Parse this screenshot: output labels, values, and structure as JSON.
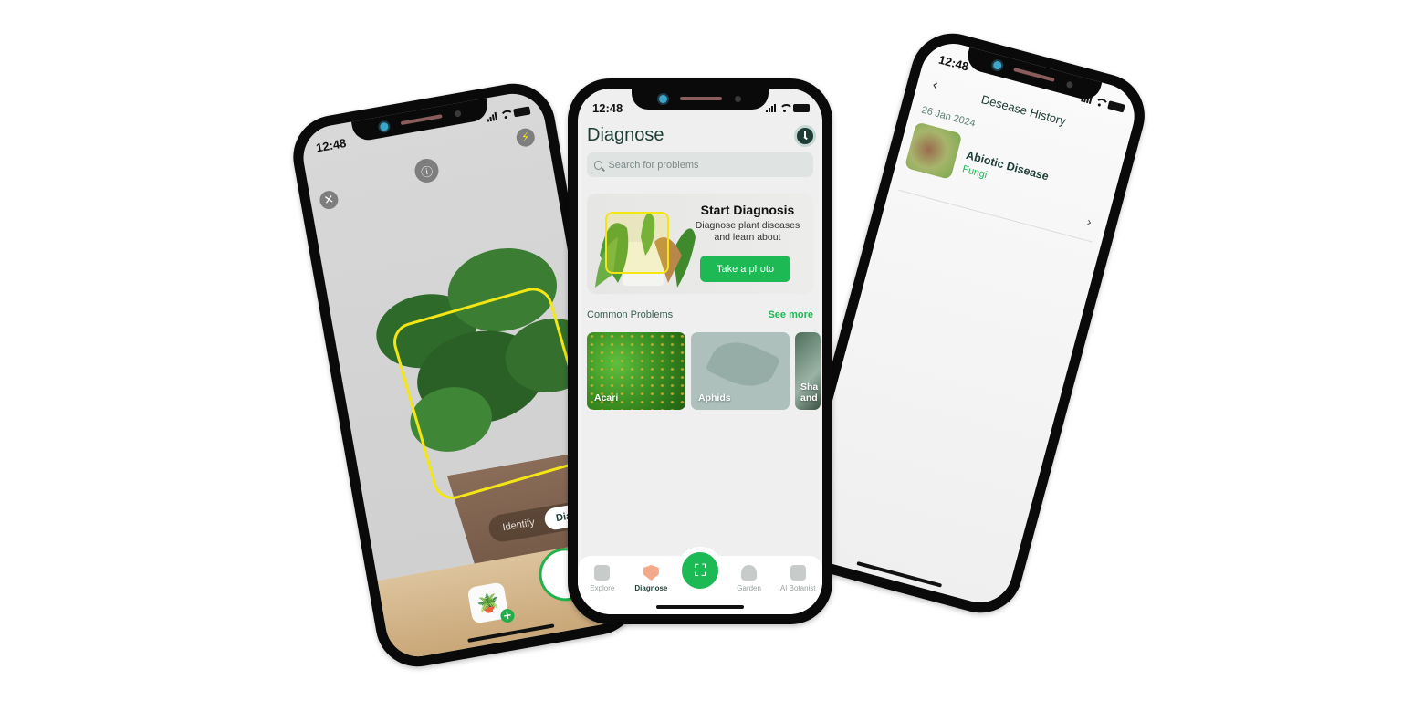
{
  "status_bar": {
    "time": "12:48"
  },
  "camera_screen": {
    "info_icon": "info-icon",
    "close_icon": "close-icon",
    "flash_icon": "lightning-icon",
    "modes": [
      "Identify",
      "Diagnosis"
    ],
    "active_mode": "Diagnosis",
    "gallery_plus": "+"
  },
  "diagnose_screen": {
    "title": "Diagnose",
    "history_icon": "clock-icon",
    "search": {
      "placeholder": "Search for problems",
      "value": ""
    },
    "promo": {
      "title": "Start Diagnosis",
      "subtitle": "Diagnose plant diseases and learn about",
      "button": "Take a photo"
    },
    "common_problems": {
      "label": "Common Problems",
      "see_more": "See more",
      "items": [
        {
          "label": "Acari"
        },
        {
          "label": "Aphids"
        },
        {
          "label": "Sha and"
        }
      ]
    },
    "tabbar": {
      "items": [
        {
          "label": "Explore",
          "icon": "explore-icon"
        },
        {
          "label": "Diagnose",
          "icon": "diagnose-shield-icon",
          "active": true
        },
        {
          "label": "",
          "icon": "scan-icon"
        },
        {
          "label": "Garden",
          "icon": "garden-icon"
        },
        {
          "label": "AI Botanist",
          "icon": "ai-botanist-icon"
        }
      ]
    }
  },
  "history_screen": {
    "title": "Desease History",
    "date": "26 Jan 2024",
    "items": [
      {
        "name": "Abiotic Disease",
        "type": "Fungi"
      }
    ]
  },
  "colors": {
    "accent": "#1db954",
    "dark_text": "#1e3d36",
    "scan_frame": "#f3e614"
  }
}
